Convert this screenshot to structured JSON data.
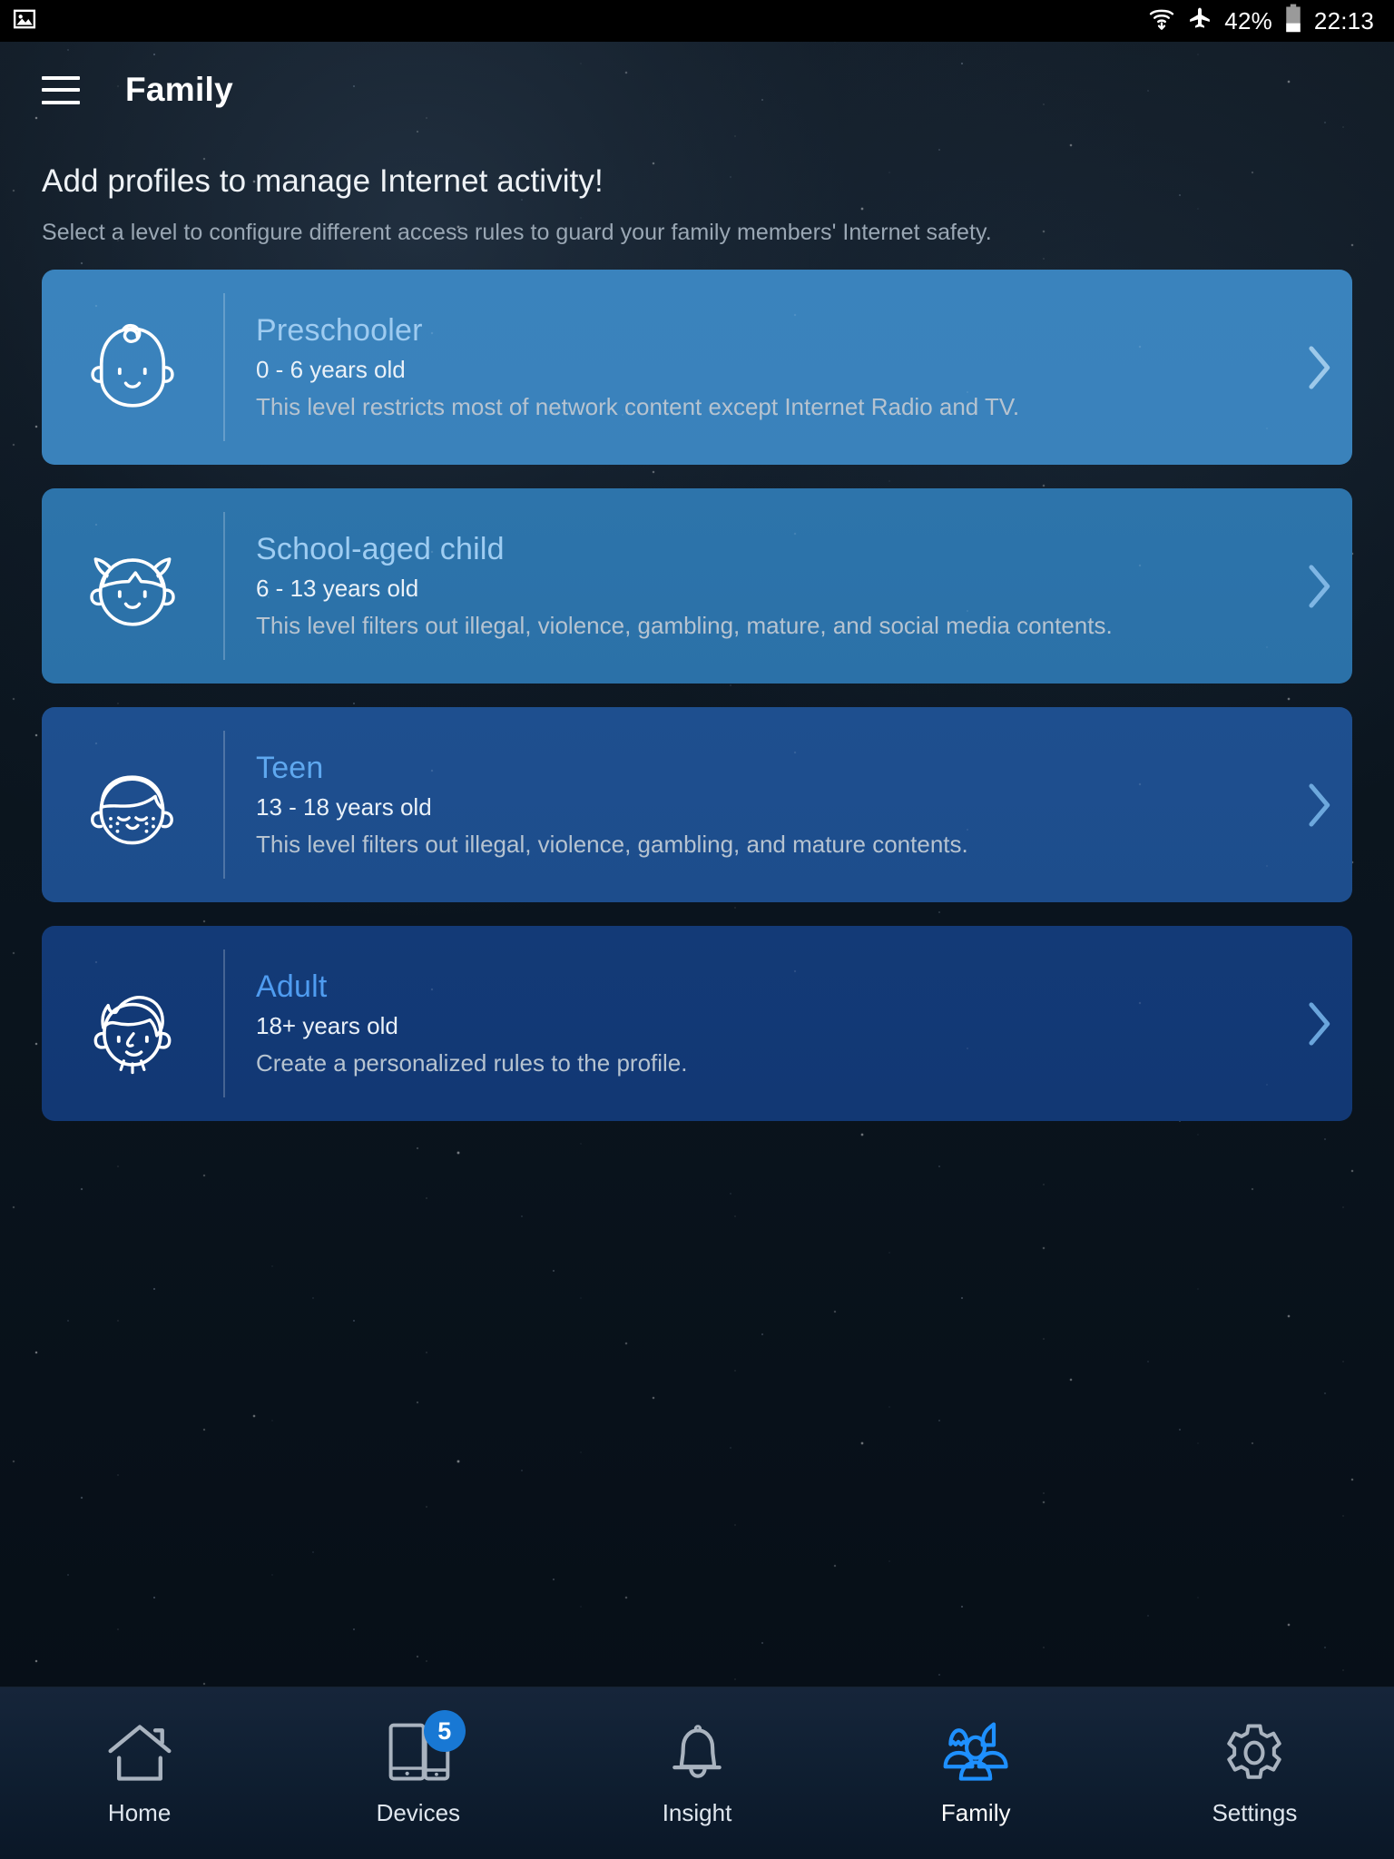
{
  "status_bar": {
    "notification_icon": "image-icon",
    "wifi_icon": "wifi-icon",
    "airplane_icon": "airplane-mode-icon",
    "battery_percent": "42%",
    "battery_icon": "battery-icon",
    "time": "22:13"
  },
  "header": {
    "menu_icon": "hamburger-menu-icon",
    "title": "Family"
  },
  "intro": {
    "title": "Add profiles to manage Internet activity!",
    "subtitle": "Select a level to configure different access rules to guard your family members' Internet safety."
  },
  "profiles": [
    {
      "id": "preschooler",
      "icon": "baby-face-icon",
      "title": "Preschooler",
      "age": "0 - 6 years old",
      "description": "This level restricts most of network content except Internet Radio and TV.",
      "color": "#3a83bd",
      "chevron": "chevron-right-icon"
    },
    {
      "id": "school-aged-child",
      "icon": "girl-face-icon",
      "title": "School-aged child",
      "age": "6 - 13 years old",
      "description": "This level filters out illegal, violence, gambling, mature, and social media contents.",
      "color": "#2d74ab",
      "chevron": "chevron-right-icon"
    },
    {
      "id": "teen",
      "icon": "teen-face-icon",
      "title": "Teen",
      "age": "13 - 18 years old",
      "description": "This level filters out illegal, violence, gambling, and mature contents.",
      "color": "#1e4f8f",
      "chevron": "chevron-right-icon"
    },
    {
      "id": "adult",
      "icon": "adult-face-icon",
      "title": "Adult",
      "age": "18+ years old",
      "description": "Create a personalized rules to the profile.",
      "color": "#133a77",
      "chevron": "chevron-right-icon"
    }
  ],
  "bottom_nav": {
    "active": "Family",
    "active_color": "#1e90ff",
    "items": [
      {
        "id": "home",
        "label": "Home",
        "icon": "house-icon",
        "badge": null,
        "active": false
      },
      {
        "id": "devices",
        "label": "Devices",
        "icon": "devices-icon",
        "badge": "5",
        "active": false
      },
      {
        "id": "insight",
        "label": "Insight",
        "icon": "bell-icon",
        "badge": null,
        "active": false
      },
      {
        "id": "family",
        "label": "Family",
        "icon": "people-icon",
        "badge": null,
        "active": true
      },
      {
        "id": "settings",
        "label": "Settings",
        "icon": "gear-icon",
        "badge": null,
        "active": false
      }
    ]
  }
}
